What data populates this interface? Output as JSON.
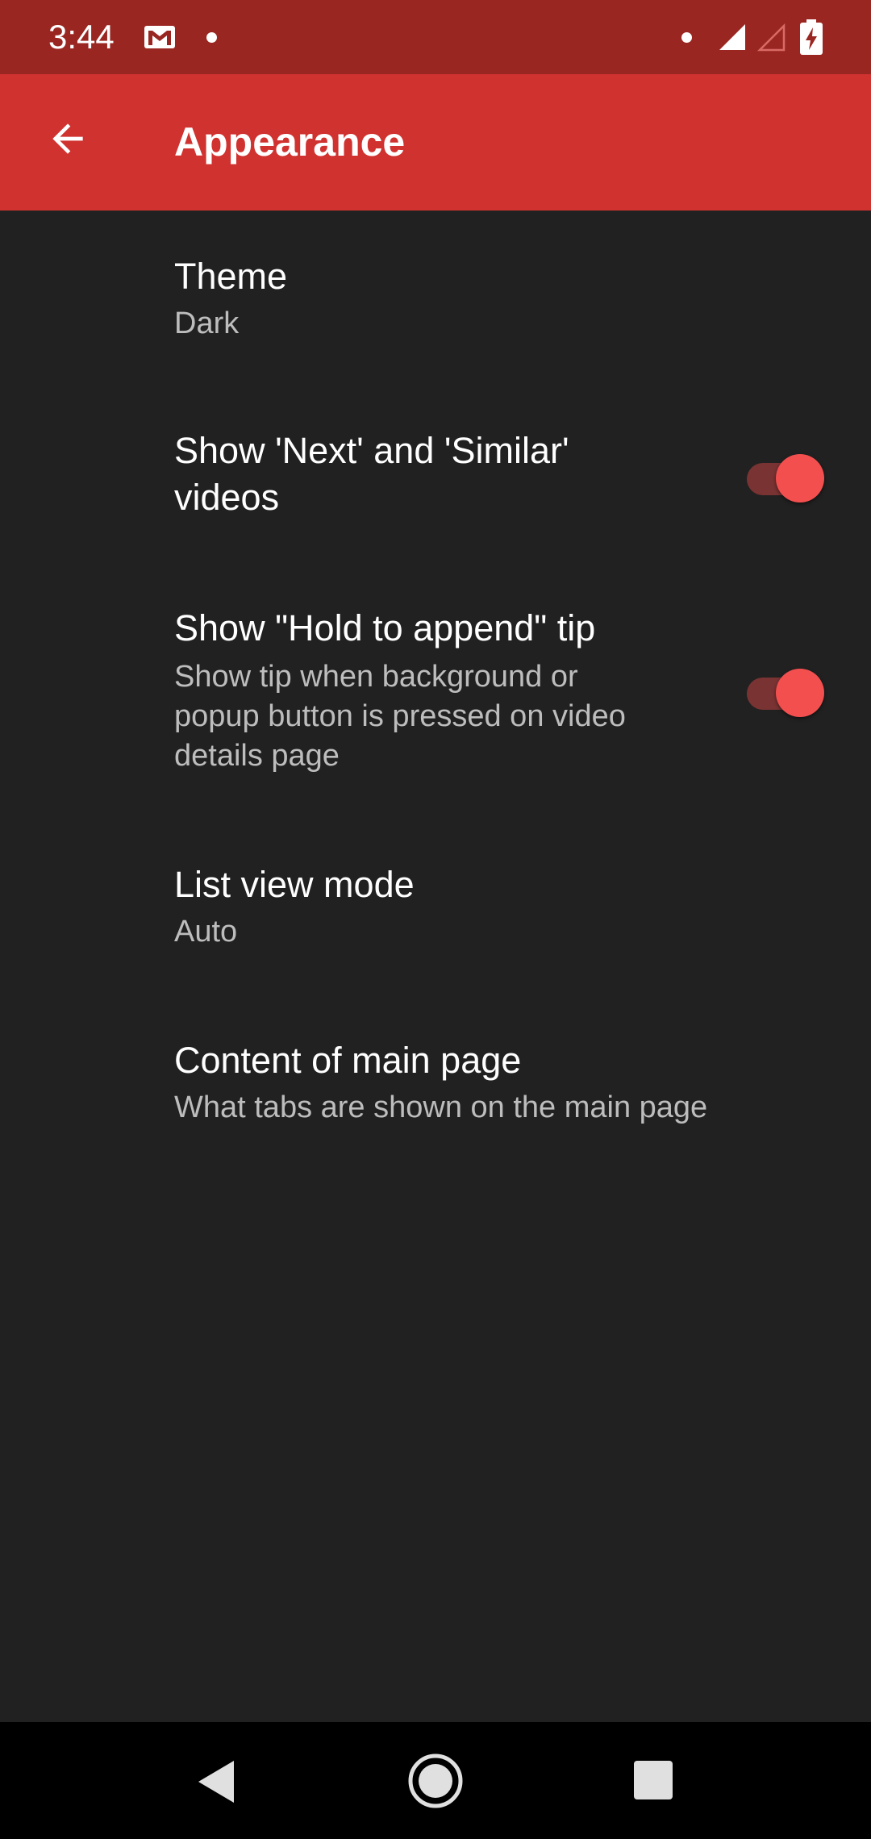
{
  "status_bar": {
    "time": "3:44",
    "icons": [
      "gmail-icon",
      "notification-dot-icon",
      "wifi-dot-icon",
      "signal-full-icon",
      "signal-empty-icon",
      "battery-charging-icon"
    ]
  },
  "app_bar": {
    "title": "Appearance",
    "back_icon": "arrow-back-icon",
    "color": "#d03230"
  },
  "preferences": [
    {
      "title": "Theme",
      "summary": "Dark"
    },
    {
      "title_line1": "Show 'Next' and 'Similar'",
      "title_line2": "videos",
      "switch_on": true
    },
    {
      "title": "Show \"Hold to append\" tip",
      "summary_line1": "Show tip when background or",
      "summary_line2": "popup button is pressed on video",
      "summary_line3": "details page",
      "switch_on": true
    },
    {
      "title": "List view mode",
      "summary": "Auto"
    },
    {
      "title": "Content of main page",
      "summary": "What tabs are shown on the main page"
    }
  ],
  "nav_bar": {
    "icons": [
      "nav-back-icon",
      "nav-home-icon",
      "nav-recents-icon"
    ]
  },
  "colors": {
    "background": "#212121",
    "status_bar": "#9a2621",
    "accent": "#f44f4f"
  }
}
